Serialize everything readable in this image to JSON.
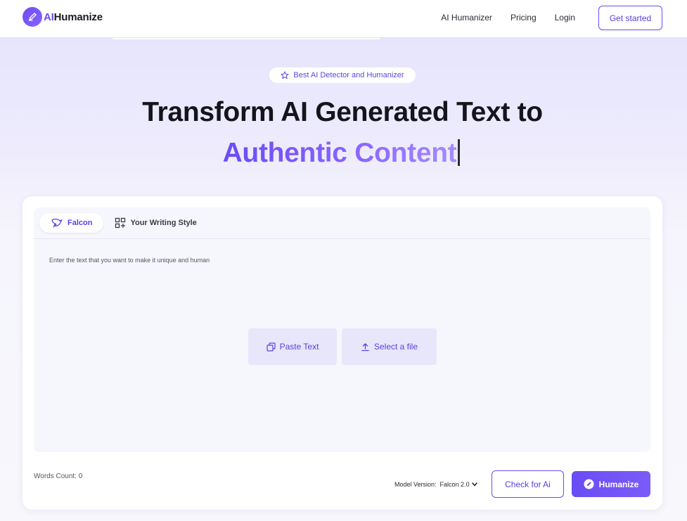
{
  "header": {
    "logo_ai": "AI",
    "logo_rest": "Humanize",
    "nav": [
      {
        "label": "AI Humanizer"
      },
      {
        "label": "Pricing"
      },
      {
        "label": "Login"
      }
    ],
    "cta_label": "Get started"
  },
  "hero": {
    "badge": "Best AI Detector and Humanizer",
    "title": "Transform AI Generated Text to",
    "subtitle": "Authentic Content"
  },
  "editor": {
    "tabs": [
      {
        "label": "Falcon",
        "active": true,
        "icon": "falcon-icon"
      },
      {
        "label": "Your Writing Style",
        "active": false,
        "icon": "grid-plus-icon"
      }
    ],
    "placeholder": "Enter the text that you want to make it unique and human",
    "paste_label": "Paste Text",
    "file_label": "Select a file"
  },
  "footer": {
    "words_count": "Words Count: 0",
    "model_version_label": "Model Version:",
    "model_version_value": "Falcon 2.0",
    "check_label": "Check for Ai",
    "humanize_label": "Humanize"
  },
  "colors": {
    "accent": "#6a4cf5",
    "accent_light": "#e8e6fb"
  }
}
